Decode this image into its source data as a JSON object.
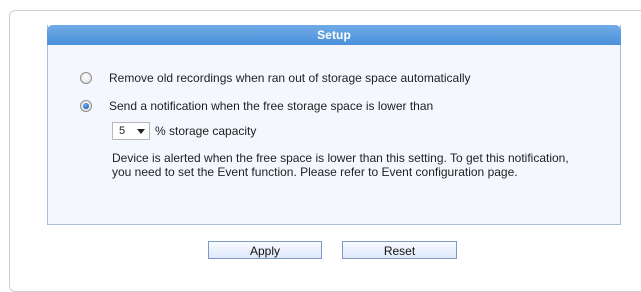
{
  "panel": {
    "title": "Setup"
  },
  "options": {
    "remove_old_recordings": {
      "label": "Remove old recordings when ran out of storage space automatically",
      "checked": false
    },
    "send_notification": {
      "label": "Send a notification when the free storage space is lower than",
      "checked": true
    }
  },
  "threshold": {
    "selected_value": "5",
    "suffix": "% storage capacity"
  },
  "description": "Device is alerted when the free space is lower than this setting. To get this notification, you need to set the Event function. Please refer to Event configuration page.",
  "buttons": {
    "apply": "Apply",
    "reset": "Reset"
  }
}
